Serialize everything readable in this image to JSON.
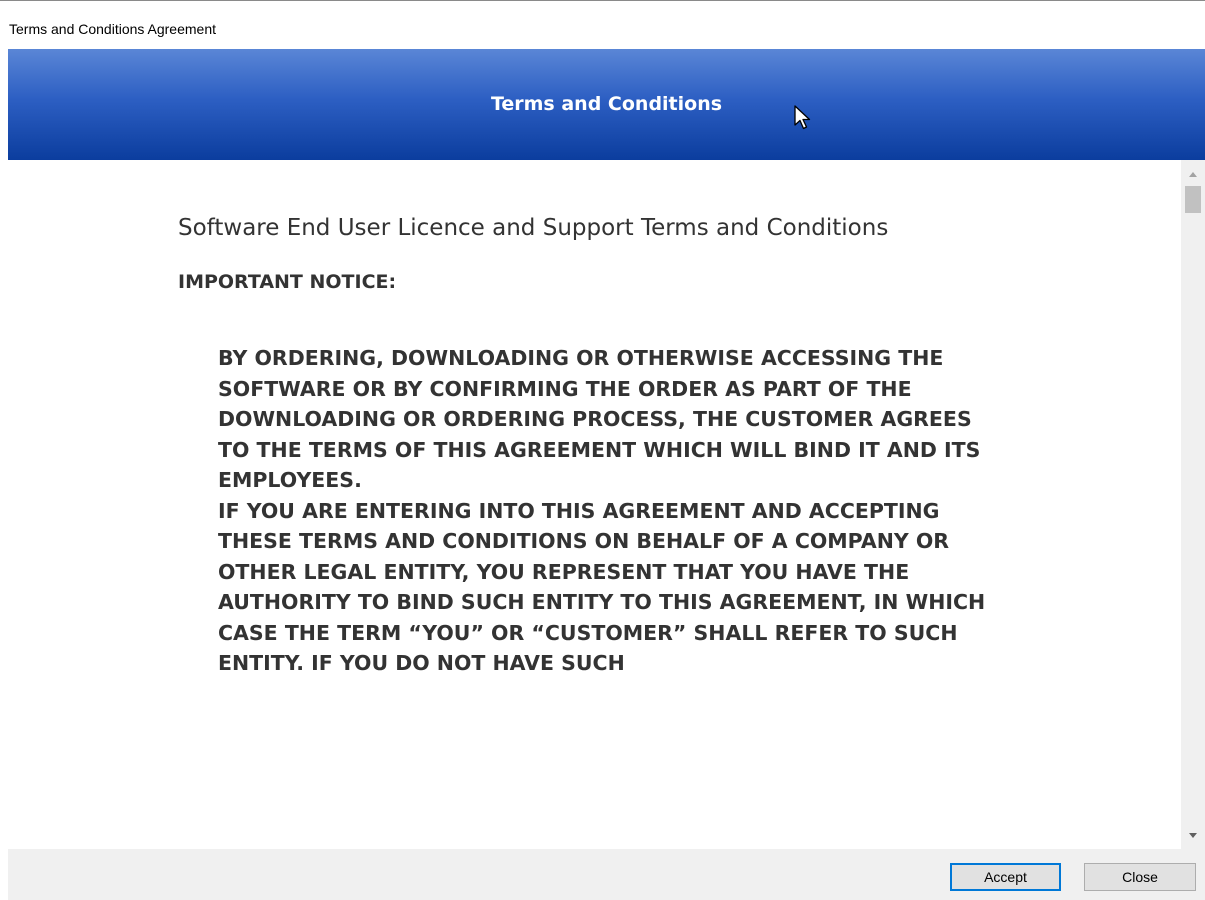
{
  "window": {
    "title": "Terms and Conditions Agreement"
  },
  "banner": {
    "title": "Terms and Conditions",
    "gradient_top": "#5a86d6",
    "gradient_bottom": "#0b3d9e"
  },
  "document": {
    "heading": "Software End User Licence and Support Terms and Conditions",
    "notice": "IMPORTANT NOTICE:",
    "paragraphs": [
      "BY ORDERING, DOWNLOADING OR OTHERWISE ACCESSING THE SOFTWARE OR BY CONFIRMING THE ORDER AS PART OF THE DOWNLOADING OR ORDERING PROCESS, THE CUSTOMER AGREES TO THE TERMS OF THIS AGREEMENT WHICH WILL BIND IT AND ITS EMPLOYEES.",
      "IF YOU ARE ENTERING INTO THIS AGREEMENT AND ACCEPTING THESE TERMS AND CONDITIONS ON BEHALF OF A COMPANY OR OTHER LEGAL ENTITY, YOU REPRESENT THAT YOU HAVE THE AUTHORITY TO BIND SUCH ENTITY TO THIS AGREEMENT, IN WHICH CASE THE TERM “YOU” OR “CUSTOMER” SHALL REFER TO SUCH ENTITY. IF YOU DO NOT HAVE SUCH"
    ]
  },
  "scrollbar": {
    "position_fraction": 0.0
  },
  "footer": {
    "accept_label": "Accept",
    "close_label": "Close"
  },
  "icons": {
    "cursor": "mouse-pointer-icon",
    "scroll_up": "scroll-up-arrow-icon",
    "scroll_down": "scroll-down-arrow-icon"
  }
}
